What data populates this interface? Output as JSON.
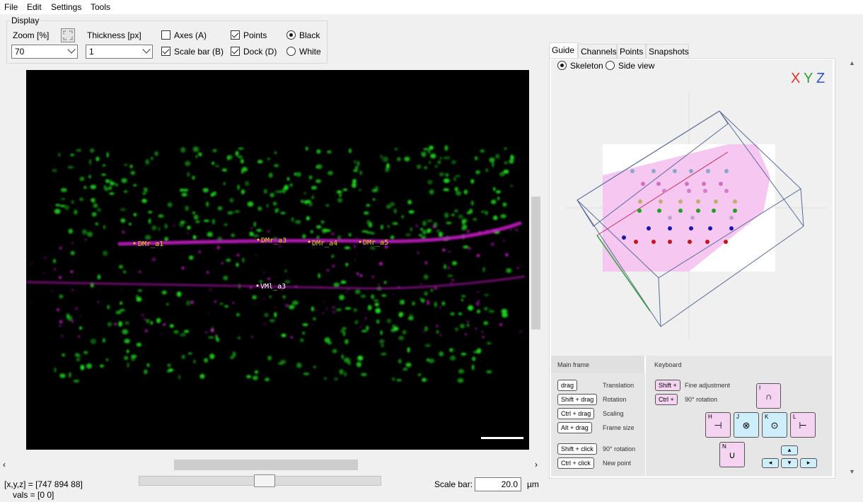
{
  "menu": [
    "File",
    "Edit",
    "Settings",
    "Tools"
  ],
  "display": {
    "title": "Display",
    "zoom_label": "Zoom [%]",
    "zoom_value": "70",
    "thickness_label": "Thickness [px]",
    "thickness_value": "1",
    "axes_label": "Axes (A)",
    "axes_checked": false,
    "scalebar_label": "Scale bar (B)",
    "scalebar_checked": true,
    "points_label": "Points",
    "points_checked": true,
    "dock_label": "Dock (D)",
    "dock_checked": true,
    "black_label": "Black",
    "white_label": "White",
    "background": "Black"
  },
  "viewer": {
    "point_labels": [
      "DMr_a1",
      "DMr_a3",
      "DMr_a4",
      "DMr_a5",
      "VMl_a3"
    ],
    "label_color": "#e0d020",
    "channel_colors": {
      "green": "#22dd22",
      "magenta": "#e020e0"
    }
  },
  "status": {
    "coords": "[x,y,z] = [747 894  88]",
    "vals": "vals = [0 0]"
  },
  "scale_bar": {
    "label": "Scale bar:",
    "value": "20.0",
    "unit": "µm"
  },
  "tabs": [
    "Guide",
    "Channels",
    "Points",
    "Snapshots"
  ],
  "active_tab": "Guide",
  "guide": {
    "skeleton_label": "Skeleton",
    "sideview_label": "Side view",
    "mode": "Skeleton",
    "axis_letters": [
      "X",
      "Y",
      "Z"
    ],
    "axis_colors": [
      "#e03030",
      "#30a030",
      "#3050d0"
    ]
  },
  "help": {
    "main_title": "Main frame",
    "keyboard_title": "Keyboard",
    "mouse": [
      {
        "key": "drag",
        "desc": "Translation"
      },
      {
        "key": "Shift + drag",
        "desc": "Rotation"
      },
      {
        "key": "Ctrl + drag",
        "desc": "Scaling"
      },
      {
        "key": "Alt + drag",
        "desc": "Frame size"
      },
      {
        "key": "Shift + click",
        "desc": "90° rotation"
      },
      {
        "key": "Ctrl + click",
        "desc": "New point"
      }
    ],
    "kb_mods": [
      {
        "key": "Shift +",
        "desc": "Fine adjustment"
      },
      {
        "key": "Ctrl +",
        "desc": "90° rotation"
      }
    ],
    "keys": [
      "I",
      "H",
      "J",
      "K",
      "L",
      "N"
    ]
  }
}
